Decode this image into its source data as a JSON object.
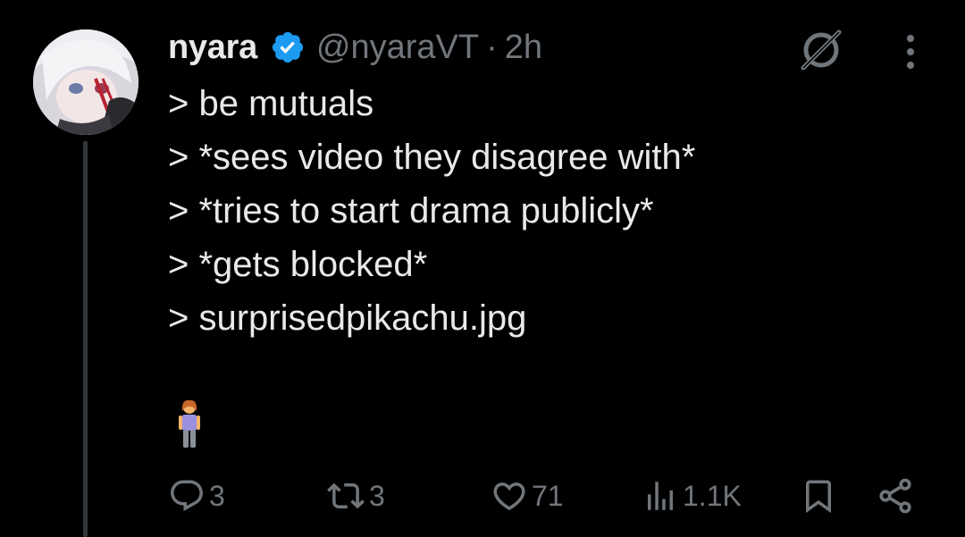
{
  "tweet": {
    "display_name": "nyara",
    "handle": "@nyaraVT",
    "separator": "·",
    "time": "2h",
    "lines": [
      "> be mutuals",
      "> *sees video they disagree with*",
      "> *tries to start drama publicly*",
      "> *gets blocked*",
      "> surprisedpikachu.jpg"
    ],
    "emoji": "🧍‍♀️"
  },
  "actions": {
    "replies": "3",
    "reposts": "3",
    "likes": "71",
    "views": "1.1K"
  },
  "colors": {
    "background": "#000000",
    "text": "#e7e9ea",
    "muted": "#71767b",
    "verified": "#1d9bf0"
  },
  "icons": [
    "avatar",
    "verified-badge-icon",
    "grok-icon",
    "more-icon",
    "reply-icon",
    "repost-icon",
    "like-icon",
    "views-icon",
    "bookmark-icon",
    "share-icon"
  ]
}
